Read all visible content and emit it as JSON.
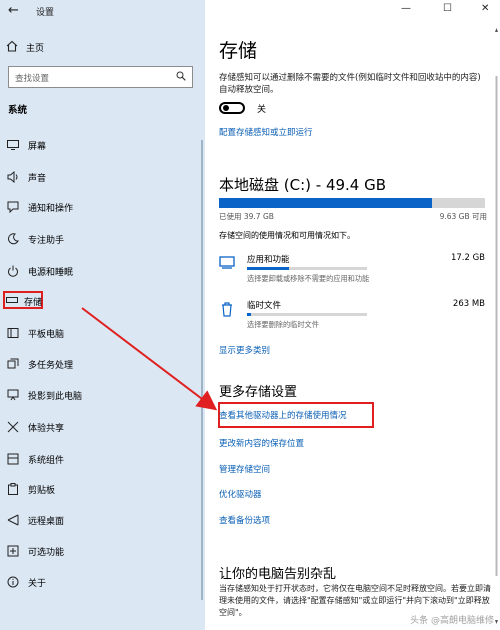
{
  "window": {
    "title": "设置",
    "back_icon": "back-arrow-icon"
  },
  "sidebar": {
    "home": "主页",
    "search_placeholder": "查找设置",
    "section": "系统",
    "items": [
      {
        "label": "屏幕",
        "icon": "monitor-icon"
      },
      {
        "label": "声音",
        "icon": "speaker-icon"
      },
      {
        "label": "通知和操作",
        "icon": "notification-icon"
      },
      {
        "label": "专注助手",
        "icon": "moon-icon"
      },
      {
        "label": "电源和睡眠",
        "icon": "power-icon"
      },
      {
        "label": "存储",
        "icon": "storage-icon",
        "selected": true
      },
      {
        "label": "平板电脑",
        "icon": "tablet-icon"
      },
      {
        "label": "多任务处理",
        "icon": "multitask-icon"
      },
      {
        "label": "投影到此电脑",
        "icon": "project-icon"
      },
      {
        "label": "体验共享",
        "icon": "share-icon"
      },
      {
        "label": "系统组件",
        "icon": "component-icon"
      },
      {
        "label": "剪贴板",
        "icon": "clipboard-icon"
      },
      {
        "label": "远程桌面",
        "icon": "remote-icon"
      },
      {
        "label": "可选功能",
        "icon": "optional-icon"
      },
      {
        "label": "关于",
        "icon": "info-icon"
      }
    ]
  },
  "main": {
    "title": "存储",
    "sense_desc": "存储感知可以通过删除不需要的文件(例如临时文件和回收站中的内容)自动释放空间。",
    "toggle_label": "关",
    "configure_link": "配置存储感知或立即运行",
    "drive_title": "本地磁盘 (C:) - 49.4 GB",
    "drive_used": "已使用 39.7 GB",
    "drive_free": "9.63 GB 可用",
    "drive_used_fraction": 0.8,
    "usage_desc": "存储空间的使用情况和可用情况如下。",
    "categories": [
      {
        "name": "应用和功能",
        "size": "17.2 GB",
        "sub": "选择要卸载或移除不需要的应用和功能",
        "fraction": 0.35,
        "icon": "apps-icon"
      },
      {
        "name": "临时文件",
        "size": "263 MB",
        "sub": "选择要删除的临时文件",
        "fraction": 0.03,
        "icon": "trash-icon"
      }
    ],
    "show_more": "显示更多类别",
    "more_title": "更多存储设置",
    "more_links": [
      "查看其他驱动器上的存储使用情况",
      "更改新内容的保存位置",
      "管理存储空间",
      "优化驱动器",
      "查看备份选项"
    ],
    "clutter_title": "让你的电脑告别杂乱",
    "clutter_desc": "当存储感知处于打开状态时，它将仅在电脑空间不足时释放空间。若要立即清理未使用的文件，请选择\"配置存储感知\"或立即运行\"并向下滚动到\"立即释放空间\"。",
    "watermark": "头条 @高朗电脑维修"
  },
  "colors": {
    "accent": "#0a63c6",
    "link": "#0a5fb4",
    "highlight": "#e02020",
    "sidebar_bg": "#dbe7f3"
  }
}
